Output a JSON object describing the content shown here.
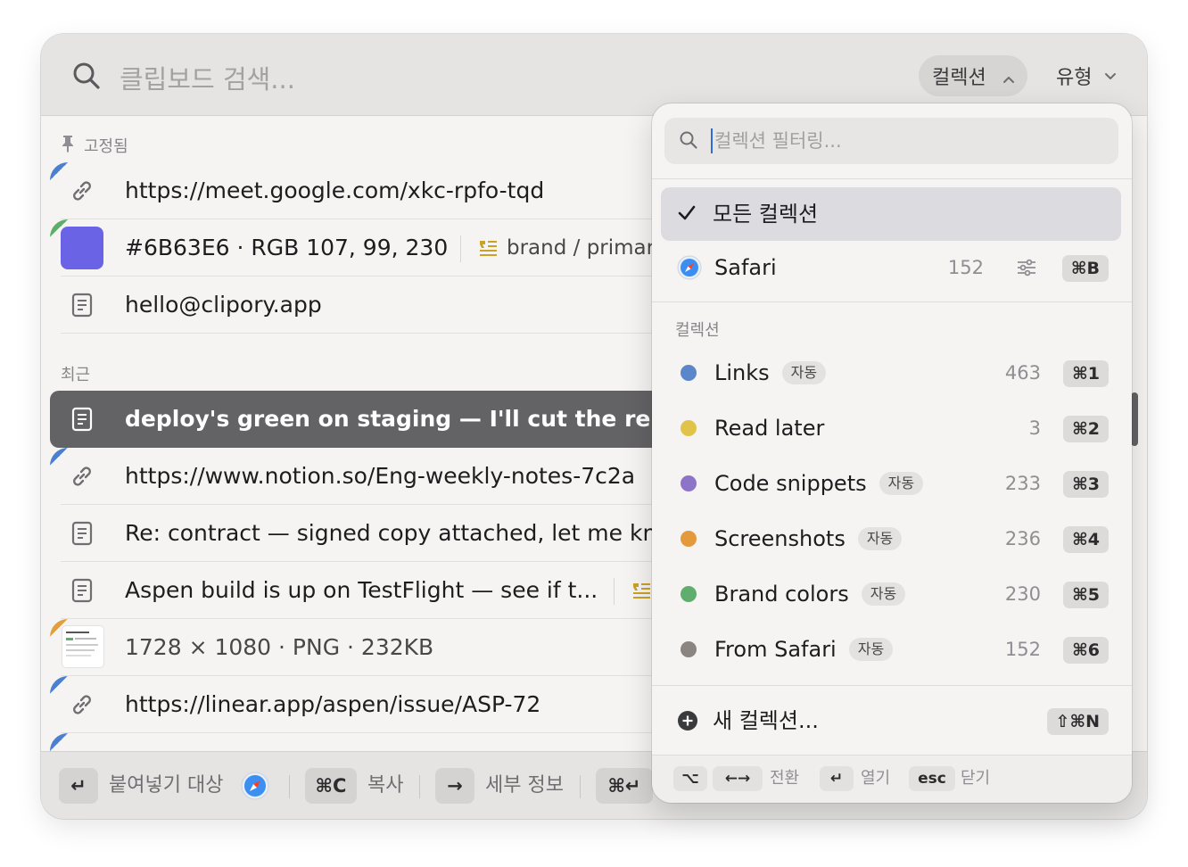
{
  "search": {
    "placeholder": "클립보드 검색..."
  },
  "filters": {
    "collection_label": "컬렉션",
    "type_label": "유형"
  },
  "pinned": {
    "header": "고정됨",
    "items": [
      {
        "kind": "link",
        "text": "https://meet.google.com/xkc-rpfo-tqd",
        "corner_color": "#4d7fd0"
      },
      {
        "kind": "color",
        "text": "#6B63E6 · RGB 107, 99, 230",
        "swatch": "#6B63E6",
        "tag": "brand / primary",
        "corner_color": "#5cae6a"
      },
      {
        "kind": "text",
        "text": "hello@clipory.app"
      }
    ]
  },
  "recent": {
    "header": "최근",
    "items": [
      {
        "kind": "text",
        "text": "deploy's green on staging — I'll cut the release a",
        "selected": true
      },
      {
        "kind": "link",
        "text": "https://www.notion.so/Eng-weekly-notes-7c2a",
        "corner_color": "#4d7fd0"
      },
      {
        "kind": "text",
        "text": "Re: contract — signed copy attached, let me knc"
      },
      {
        "kind": "text",
        "text": "Aspen build is up on TestFlight — see if t..."
      },
      {
        "kind": "image",
        "text": "1728 × 1080 · PNG · 232KB",
        "corner_color": "#e0a040"
      },
      {
        "kind": "link",
        "text": "https://linear.app/aspen/issue/ASP-72",
        "corner_color": "#4d7fd0"
      }
    ]
  },
  "footer": {
    "enter_key": "↵",
    "paste_label": "붙여넣기 대상",
    "copy_key": "⌘C",
    "copy_label": "복사",
    "detail_key": "→",
    "detail_label": "세부 정보",
    "cmd_enter_key": "⌘↵"
  },
  "popover": {
    "filter_placeholder": "컬렉션 필터링...",
    "all_label": "모든 컬렉션",
    "app_item": {
      "label": "Safari",
      "count": "152",
      "shortcut": "⌘B"
    },
    "section_header": "컬렉션",
    "auto_badge": "자동",
    "collections": [
      {
        "label": "Links",
        "auto": true,
        "count": "463",
        "shortcut": "⌘1",
        "color": "#5b86c9"
      },
      {
        "label": "Read later",
        "auto": false,
        "count": "3",
        "shortcut": "⌘2",
        "color": "#e2c34a"
      },
      {
        "label": "Code snippets",
        "auto": true,
        "count": "233",
        "shortcut": "⌘3",
        "color": "#8e74c8"
      },
      {
        "label": "Screenshots",
        "auto": true,
        "count": "236",
        "shortcut": "⌘4",
        "color": "#e29a3c"
      },
      {
        "label": "Brand colors",
        "auto": true,
        "count": "230",
        "shortcut": "⌘5",
        "color": "#5fae6e"
      },
      {
        "label": "From Safari",
        "auto": true,
        "count": "152",
        "shortcut": "⌘6",
        "color": "#8a8580"
      }
    ],
    "new_collection": {
      "label": "새 컬렉션...",
      "shortcut": "⇧⌘N"
    },
    "hints": {
      "option_key": "⌥",
      "arrows_key": "←→",
      "switch_label": "전환",
      "enter_key": "↵",
      "open_label": "열기",
      "esc_key": "esc",
      "close_label": "닫기"
    }
  }
}
